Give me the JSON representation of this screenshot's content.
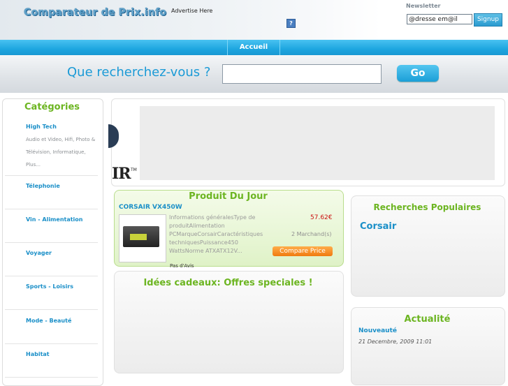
{
  "header": {
    "logo_text": "Comparateur de Prix.info",
    "advertise_text": "Advertise Here",
    "ad_icon_glyph": "?",
    "newsletter_label": "Newsletter",
    "newsletter_value": "@dresse em@il",
    "signup_label": "Signup"
  },
  "nav": {
    "accueil_label": "Accueil"
  },
  "search": {
    "label": "Que recherchez-vous ?",
    "value": "",
    "go_label": "Go"
  },
  "categories": {
    "title": "Catégories",
    "items": [
      {
        "label": "High Tech",
        "sub": "Audio et Video, Hifi, Photo & Télévision, Informatique, Plus..."
      },
      {
        "label": "Télephonie"
      },
      {
        "label": "Vin - Alimentation"
      },
      {
        "label": "Voyager"
      },
      {
        "label": "Sports - Loisirs"
      },
      {
        "label": "Mode - Beauté"
      },
      {
        "label": "Habitat"
      }
    ]
  },
  "banner": {
    "logo_text": "IR",
    "tm": "TM"
  },
  "produit_du_jour": {
    "title": "Produit Du Jour",
    "name": "CORSAIR VX450W",
    "description": "Informations généralesType de produitAlimentation PCMarqueCorsairCaractéristiques techniquesPuissance450 WattsNorme ATXATX12V...",
    "price": "57.62€",
    "merchants": "2 Marchand(s)",
    "compare_label": "Compare Price",
    "avis": "Pas d'Avis"
  },
  "idees": {
    "title": "Idées cadeaux: Offres speciales !"
  },
  "recherches": {
    "title": "Recherches Populaires",
    "items": [
      "Corsair"
    ]
  },
  "actualite": {
    "title": "Actualité",
    "item_title": "Nouveauté",
    "item_date": "21 Decembre, 2009 11:01"
  }
}
